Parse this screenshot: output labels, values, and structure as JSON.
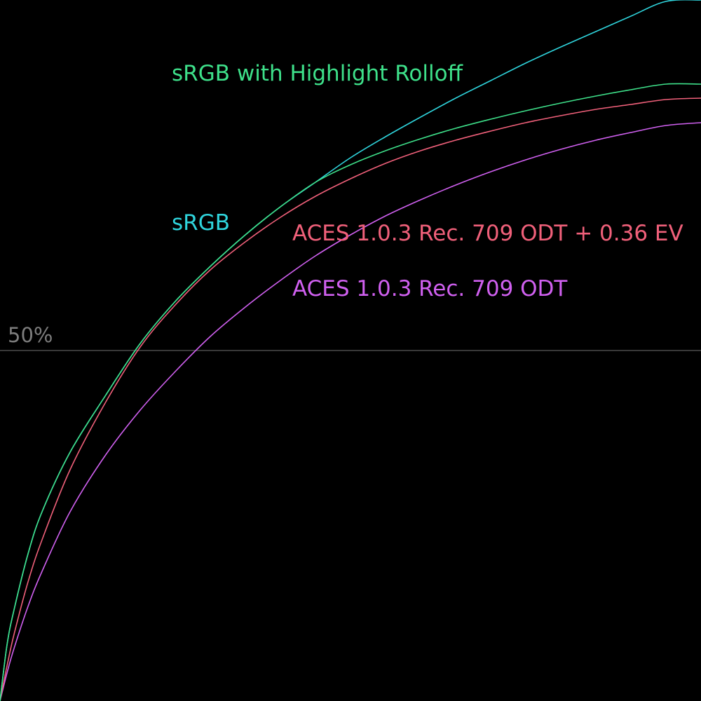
{
  "chart_data": {
    "type": "line",
    "title": "",
    "xlabel": "",
    "ylabel": "",
    "grid": false,
    "background": "#000000",
    "reference_lines": [
      {
        "y": 50,
        "label": "50%",
        "color": "#5a5a5a",
        "label_color": "#7d7d7d"
      }
    ],
    "series": [
      {
        "name": "sRGB with Highlight Rolloff",
        "color": "#3ee08a",
        "x": [
          0,
          1,
          2,
          4,
          6,
          10,
          15,
          20,
          25,
          30,
          35,
          40,
          45,
          50,
          55,
          60,
          65,
          70,
          75,
          80,
          85,
          90,
          95,
          100
        ],
        "y": [
          0,
          8,
          13,
          21,
          27,
          35.5,
          43.5,
          51,
          57,
          62,
          66.5,
          70.5,
          74,
          76.5,
          78.5,
          80.2,
          81.7,
          83,
          84.2,
          85.3,
          86.3,
          87.2,
          88,
          88
        ]
      },
      {
        "name": "sRGB",
        "color": "#2fd4dc",
        "x": [
          0,
          1,
          2,
          4,
          6,
          10,
          15,
          20,
          25,
          30,
          35,
          40,
          45,
          50,
          55,
          60,
          65,
          70,
          75,
          80,
          85,
          90,
          95,
          100
        ],
        "y": [
          0,
          8,
          13,
          21,
          27,
          35.5,
          43.5,
          51,
          57,
          62,
          66.5,
          70.5,
          74,
          77.5,
          80.5,
          83.3,
          86,
          88.5,
          91,
          93.3,
          95.5,
          97.7,
          99.8,
          100
        ]
      },
      {
        "name": "ACES 1.0.3 Rec. 709 ODT + 0.36 EV",
        "color": "#f0607a",
        "x": [
          0,
          1,
          2,
          4,
          6,
          10,
          15,
          20,
          25,
          30,
          35,
          40,
          45,
          50,
          55,
          60,
          65,
          70,
          75,
          80,
          85,
          90,
          95,
          100
        ],
        "y": [
          0,
          5,
          9.5,
          17,
          23,
          33,
          42.5,
          50.5,
          56.5,
          61.5,
          65.5,
          69,
          72,
          74.5,
          76.7,
          78.5,
          80,
          81.3,
          82.5,
          83.5,
          84.4,
          85.1,
          85.8,
          86
        ]
      },
      {
        "name": "ACES 1.0.3 Rec. 709 ODT",
        "color": "#d060f0",
        "x": [
          0,
          1,
          2,
          4,
          6,
          10,
          15,
          20,
          25,
          30,
          35,
          40,
          45,
          50,
          55,
          60,
          65,
          70,
          75,
          80,
          85,
          90,
          95,
          100
        ],
        "y": [
          0,
          4,
          7.5,
          13.5,
          18.5,
          27,
          35,
          41.5,
          47,
          52,
          56.2,
          60,
          63.5,
          66.5,
          69.2,
          71.5,
          73.6,
          75.5,
          77.2,
          78.7,
          80,
          81.1,
          82.1,
          82.5
        ]
      }
    ],
    "annotations": [
      {
        "series": 0,
        "text": "sRGB with Highlight Rolloff",
        "x": 24.5,
        "y": 88.5,
        "color": "#3ee08a"
      },
      {
        "series": 1,
        "text": "sRGB",
        "x": 24.5,
        "y": 67.2,
        "color": "#2fd4dc"
      },
      {
        "series": 2,
        "text": "ACES 1.0.3 Rec. 709 ODT + 0.36 EV",
        "x": 41.7,
        "y": 65.7,
        "color": "#f0607a"
      },
      {
        "series": 3,
        "text": "ACES 1.0.3 Rec. 709 ODT",
        "x": 41.7,
        "y": 57.8,
        "color": "#d060f0"
      }
    ],
    "xlim": [
      0,
      100
    ],
    "ylim": [
      0,
      100
    ]
  }
}
